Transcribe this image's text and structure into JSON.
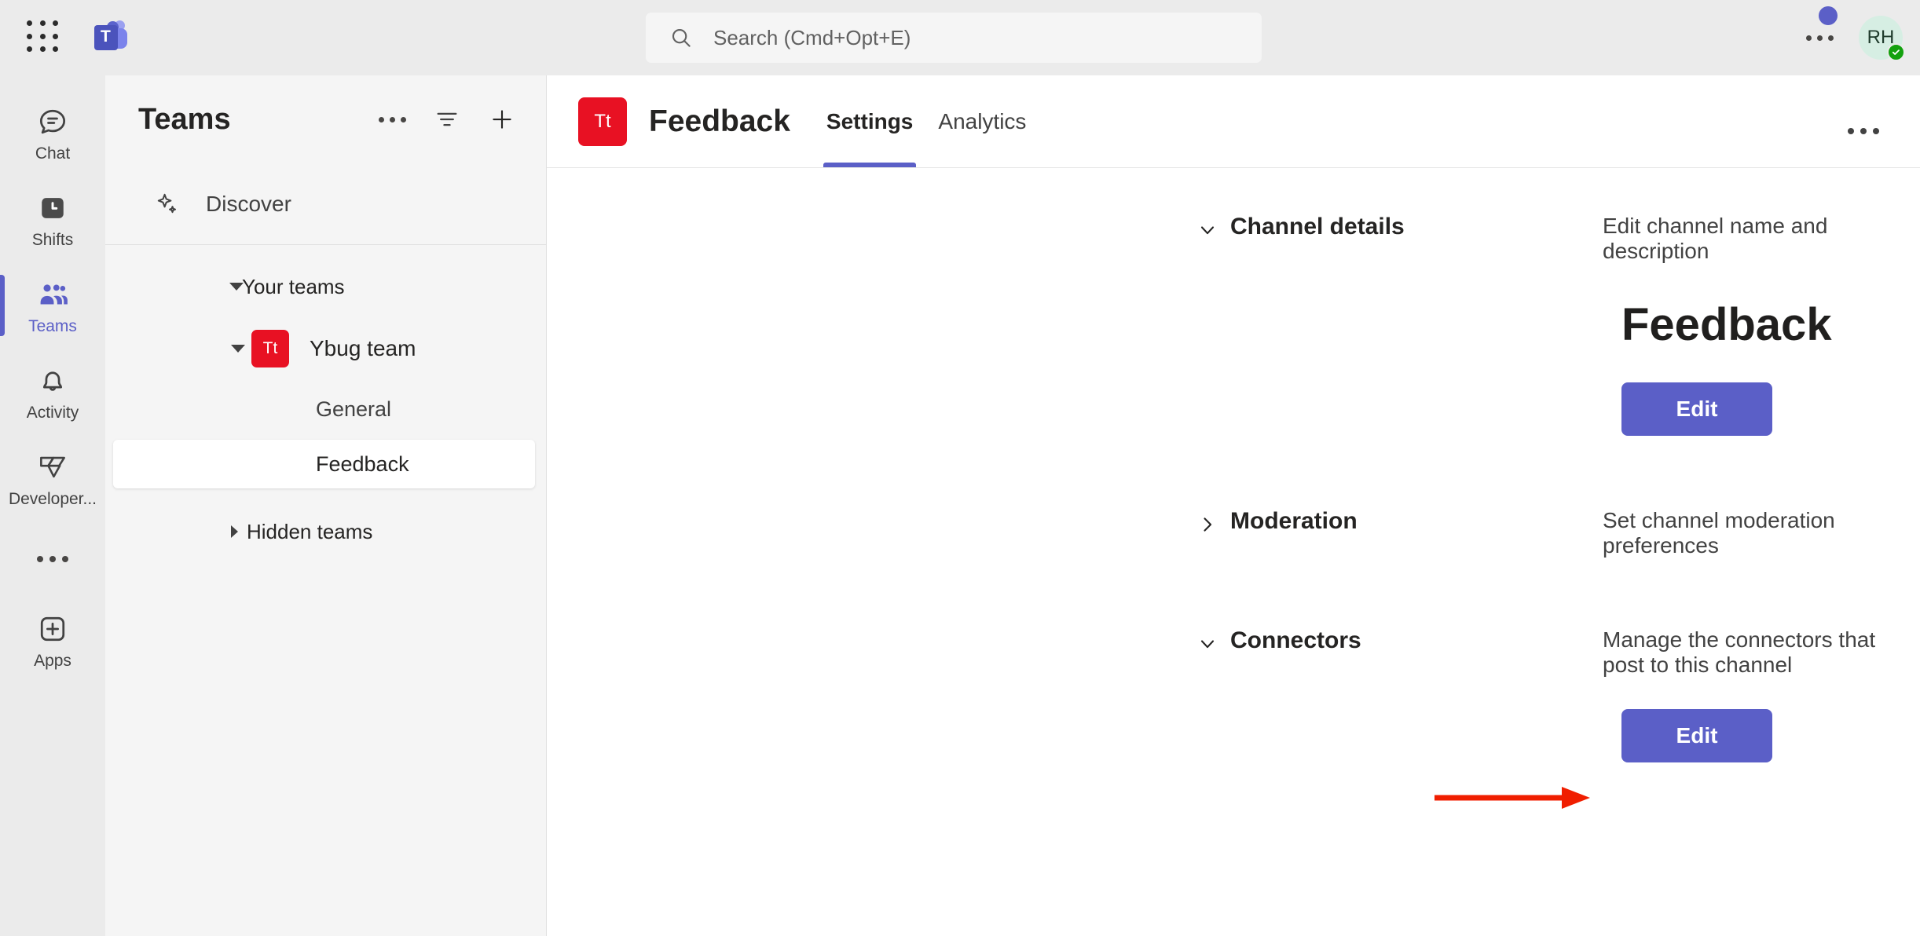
{
  "topbar": {
    "waffle_icon": "app-grid-icon",
    "logo_icon": "microsoft-teams-logo",
    "logo_letter": "T",
    "search": {
      "placeholder": "Search (Cmd+Opt+E)",
      "value": "",
      "icon": "search-icon"
    },
    "more_icon": "more-options-icon",
    "notification_dot": true,
    "avatar": {
      "initials": "RH",
      "presence": "Available",
      "presence_color": "#13A10E",
      "background_color": "#D6EEE3"
    }
  },
  "rail": {
    "items": [
      {
        "label": "Chat",
        "icon": "chat-icon",
        "active": false
      },
      {
        "label": "Shifts",
        "icon": "shifts-icon",
        "active": false
      },
      {
        "label": "Teams",
        "icon": "teams-icon",
        "active": true
      },
      {
        "label": "Activity",
        "icon": "bell-icon",
        "active": false
      },
      {
        "label": "Developer...",
        "icon": "developer-portal-icon",
        "active": false
      }
    ],
    "more_icon": "more-apps-icon",
    "apps": {
      "label": "Apps",
      "icon": "apps-plus-icon"
    },
    "active_color": "#5B5FC7"
  },
  "panel": {
    "title": "Teams",
    "actions": [
      {
        "name": "more-options",
        "icon": "more-options-icon"
      },
      {
        "name": "filter",
        "icon": "filter-icon"
      },
      {
        "name": "join-or-create-team",
        "icon": "plus-icon"
      }
    ],
    "discover": {
      "label": "Discover",
      "icon": "sparkle-icon"
    },
    "your_teams": {
      "label": "Your teams",
      "expanded": true
    },
    "teams": [
      {
        "name": "Ybug team",
        "avatar_initials": "Tt",
        "avatar_color": "#E81123",
        "expanded": true,
        "channels": [
          {
            "name": "General",
            "selected": false
          },
          {
            "name": "Feedback",
            "selected": true
          }
        ]
      }
    ],
    "hidden_teams": {
      "label": "Hidden teams",
      "expanded": false
    }
  },
  "main": {
    "header": {
      "avatar_initials": "Tt",
      "avatar_color": "#E81123",
      "channel_title": "Feedback",
      "tabs": [
        {
          "label": "Settings",
          "active": true
        },
        {
          "label": "Analytics",
          "active": false
        }
      ],
      "more_icon": "more-options-icon"
    },
    "sections": [
      {
        "title": "Channel details",
        "description": "Edit channel name and description",
        "expanded": true,
        "channel_name": "Feedback",
        "button_label": "Edit"
      },
      {
        "title": "Moderation",
        "description": "Set channel moderation preferences",
        "expanded": false
      },
      {
        "title": "Connectors",
        "description": "Manage the connectors that post to this channel",
        "expanded": true,
        "button_label": "Edit"
      }
    ],
    "annotation": {
      "type": "arrow",
      "color": "#F01E00",
      "points_to": "connectors-edit-button"
    }
  },
  "colors": {
    "accent": "#5B5FC7",
    "team_red": "#E81123",
    "annotation_red": "#F01E00",
    "chrome_gray": "#EBEBEB",
    "panel_gray": "#F5F5F5"
  }
}
